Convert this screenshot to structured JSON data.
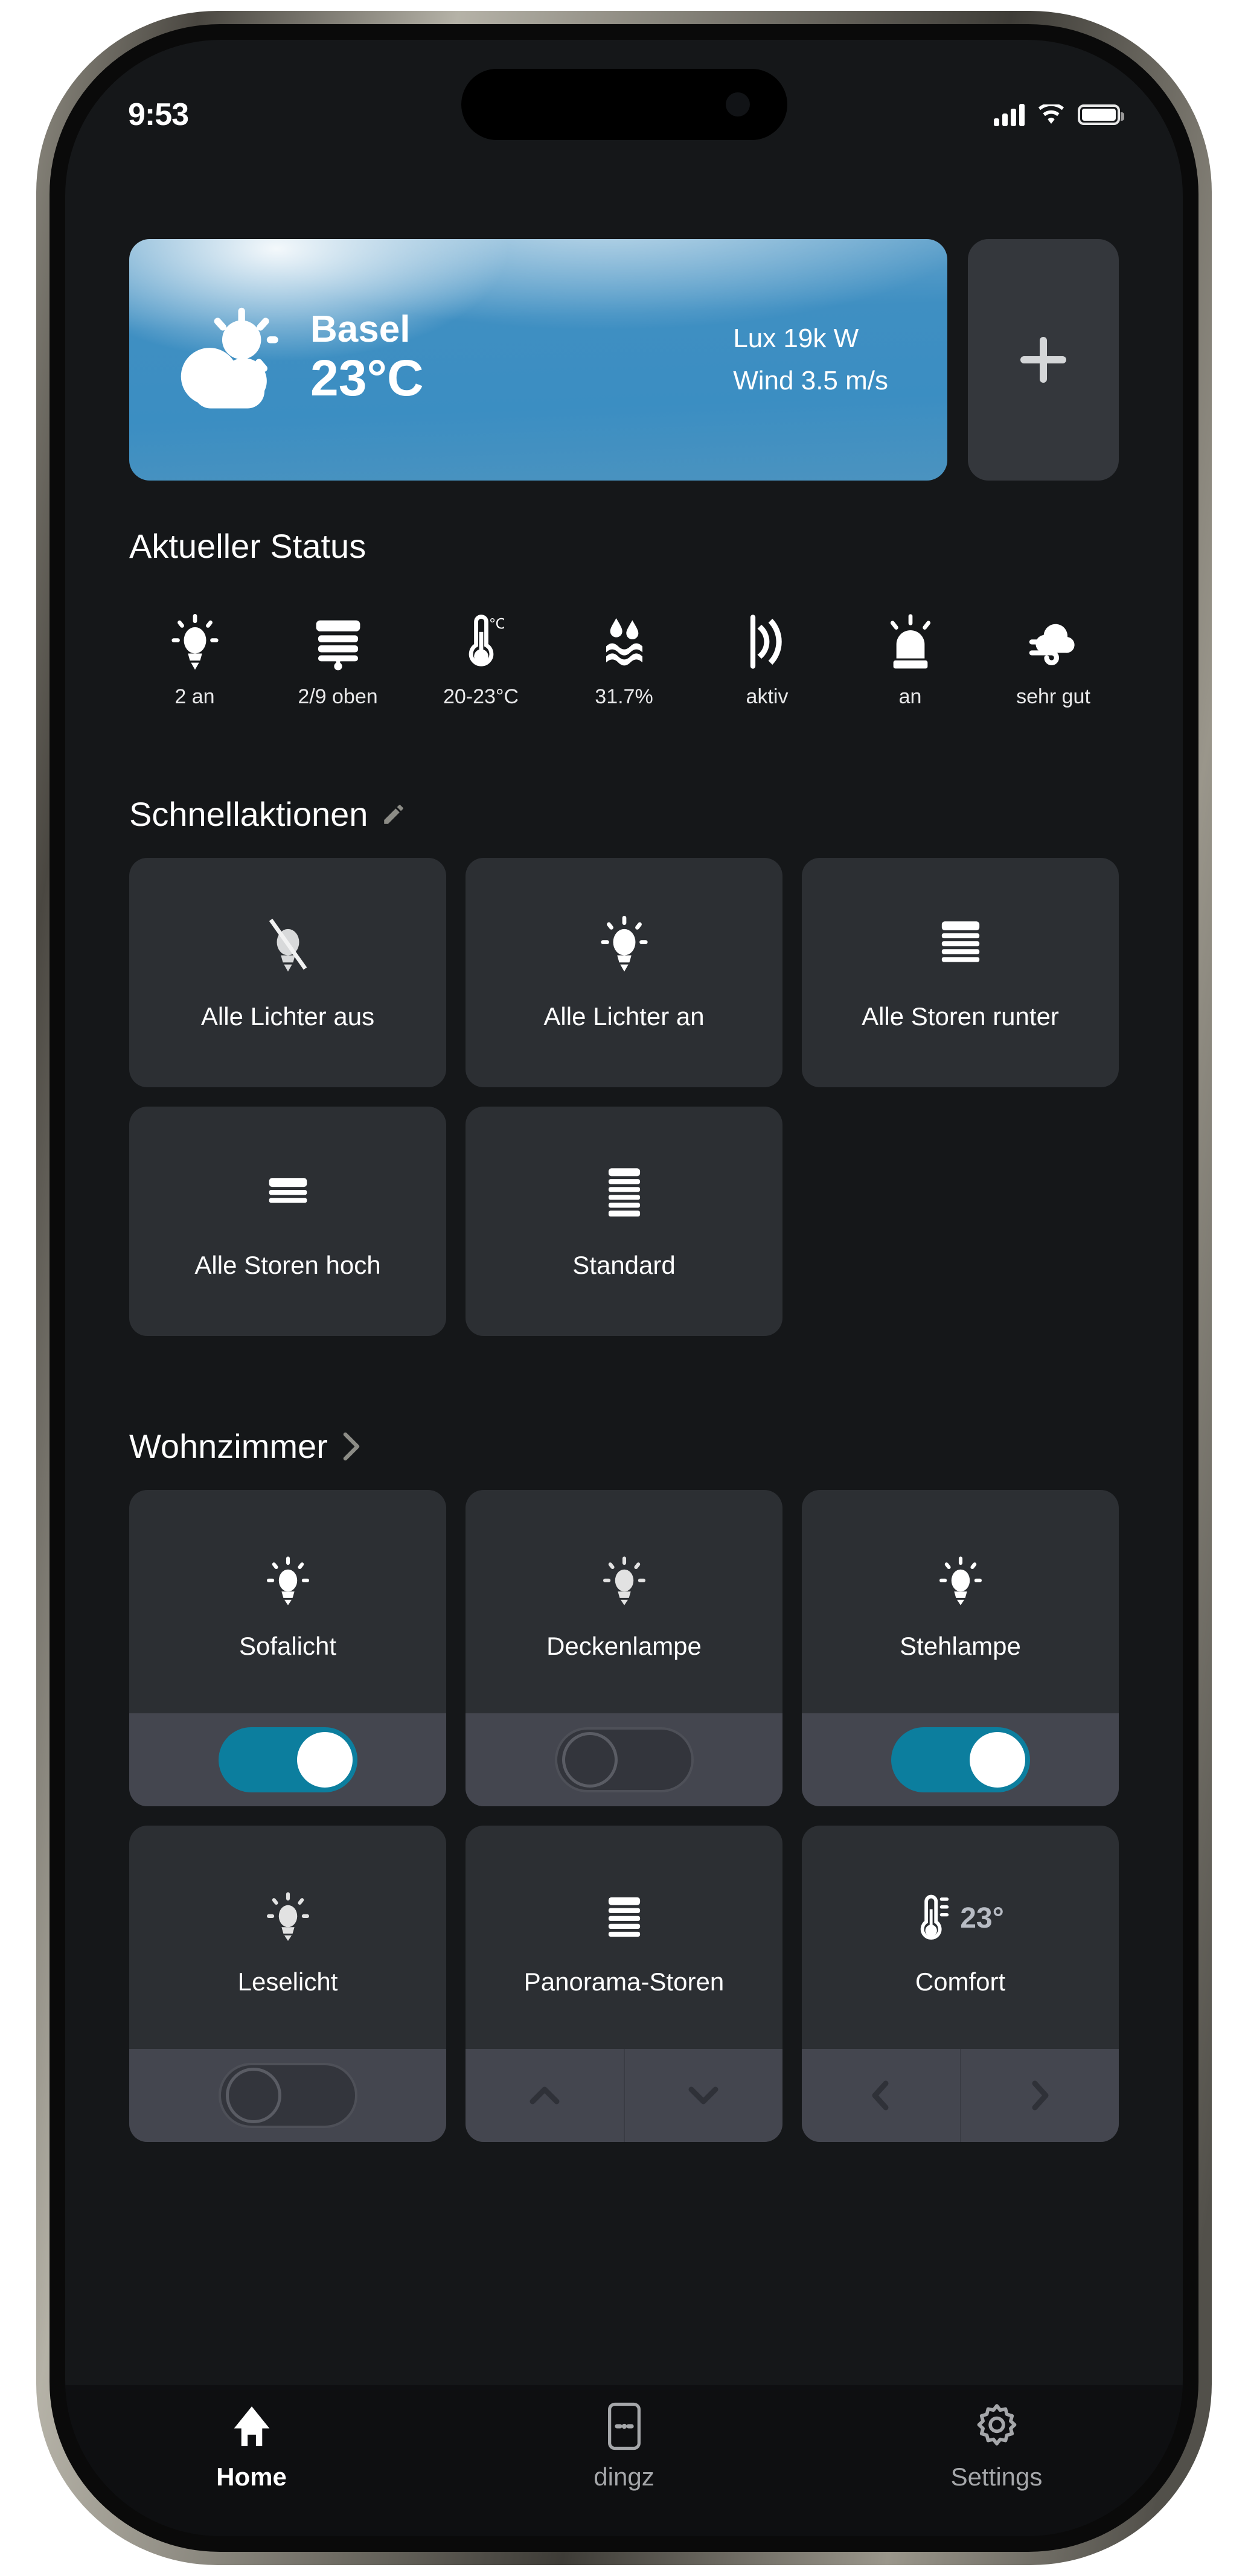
{
  "status_bar": {
    "time": "9:53",
    "cellular_icon": "signal-bars-icon",
    "wifi_icon": "wifi-icon",
    "battery_icon": "battery-full-icon"
  },
  "weather": {
    "icon": "sun-behind-cloud-icon",
    "city": "Basel",
    "temperature": "23°C",
    "lux": "Lux 19k W",
    "wind": "Wind 3.5 m/s"
  },
  "add_widget": {
    "label": "+",
    "icon": "plus-icon"
  },
  "current_status": {
    "title": "Aktueller Status",
    "items": [
      {
        "icon": "lightbulb-icon",
        "label": "2 an"
      },
      {
        "icon": "blinds-partial-icon",
        "label": "2/9 oben"
      },
      {
        "icon": "thermometer-icon",
        "label": "20-23°C"
      },
      {
        "icon": "humidity-icon",
        "label": "31.7%"
      },
      {
        "icon": "motion-sensor-icon",
        "label": "aktiv"
      },
      {
        "icon": "siren-icon",
        "label": "an"
      },
      {
        "icon": "air-quality-icon",
        "label": "sehr gut"
      }
    ]
  },
  "quick_actions": {
    "title": "Schnellaktionen",
    "edit_icon": "pencil-icon",
    "items": [
      {
        "icon": "lightbulb-off-icon",
        "label": "Alle Lichter aus"
      },
      {
        "icon": "lightbulb-on-icon",
        "label": "Alle Lichter an"
      },
      {
        "icon": "blinds-down-icon",
        "label": "Alle Storen runter"
      },
      {
        "icon": "blinds-up-icon",
        "label": "Alle Storen hoch"
      },
      {
        "icon": "blinds-default-icon",
        "label": "Standard"
      }
    ]
  },
  "room": {
    "title": "Wohnzimmer",
    "chevron_icon": "chevron-right-icon",
    "devices": [
      {
        "icon": "lightbulb-on-icon",
        "label": "Sofalicht",
        "control": "toggle",
        "state": "on"
      },
      {
        "icon": "lightbulb-on-icon",
        "label": "Deckenlampe",
        "control": "toggle",
        "state": "off"
      },
      {
        "icon": "lightbulb-on-icon",
        "label": "Stehlampe",
        "control": "toggle",
        "state": "on"
      },
      {
        "icon": "lightbulb-on-icon",
        "label": "Leselicht",
        "control": "toggle",
        "state": "off"
      },
      {
        "icon": "blinds-down-icon",
        "label": "Panorama-Storen",
        "control": "updown"
      },
      {
        "icon": "thermometer-icon",
        "label": "Comfort",
        "value": "23°",
        "control": "leftright"
      }
    ]
  },
  "bottom_nav": {
    "items": [
      {
        "icon": "home-icon",
        "label": "Home",
        "active": true
      },
      {
        "icon": "dingz-icon",
        "label": "dingz",
        "active": false
      },
      {
        "icon": "gear-icon",
        "label": "Settings",
        "active": false
      }
    ]
  },
  "colors": {
    "accent_teal": "#0c7e9e",
    "card_bg": "#2c2f33",
    "control_bg": "#44464f",
    "screen_bg": "#151719",
    "nav_bg": "#0e0f11"
  }
}
